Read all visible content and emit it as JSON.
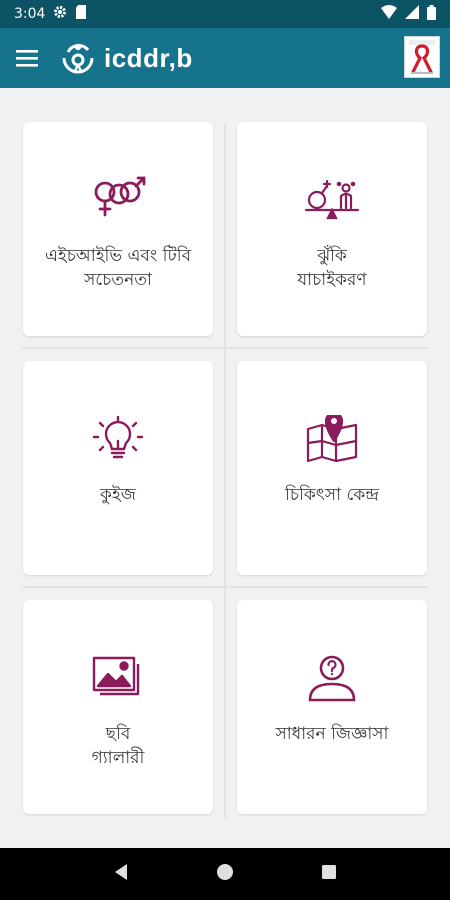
{
  "status_bar": {
    "time": "3:04",
    "icons": [
      "gear-icon",
      "sd-card-icon",
      "wifi-icon",
      "cellular-icon",
      "battery-icon"
    ]
  },
  "app_bar": {
    "title": "icddr,b",
    "menu_icon": "hamburger-menu-icon",
    "partner_logo": "red-ribbon-logo"
  },
  "colors": {
    "status_bar": "#0d5366",
    "app_bar": "#16738c",
    "accent": "#8b1c5c",
    "background": "#f1f1f1"
  },
  "menu": {
    "items": [
      {
        "label": "এইচআইভি এবং টিবি\nসচেতনতা",
        "icon": "gender-symbols-icon"
      },
      {
        "label": "ঝুঁকি\nযাচাইকরণ",
        "icon": "risk-scale-icon"
      },
      {
        "label": "কুইজ",
        "icon": "lightbulb-icon"
      },
      {
        "label": "চিকিৎসা কেন্দ্র",
        "icon": "map-pin-icon"
      },
      {
        "label": "ছবি\nগ্যালারী",
        "icon": "image-gallery-icon"
      },
      {
        "label": "সাধারন জিজ্ঞাসা",
        "icon": "faq-person-icon"
      }
    ]
  },
  "nav_bar": {
    "icons": [
      "back-icon",
      "home-icon",
      "recents-icon"
    ]
  }
}
